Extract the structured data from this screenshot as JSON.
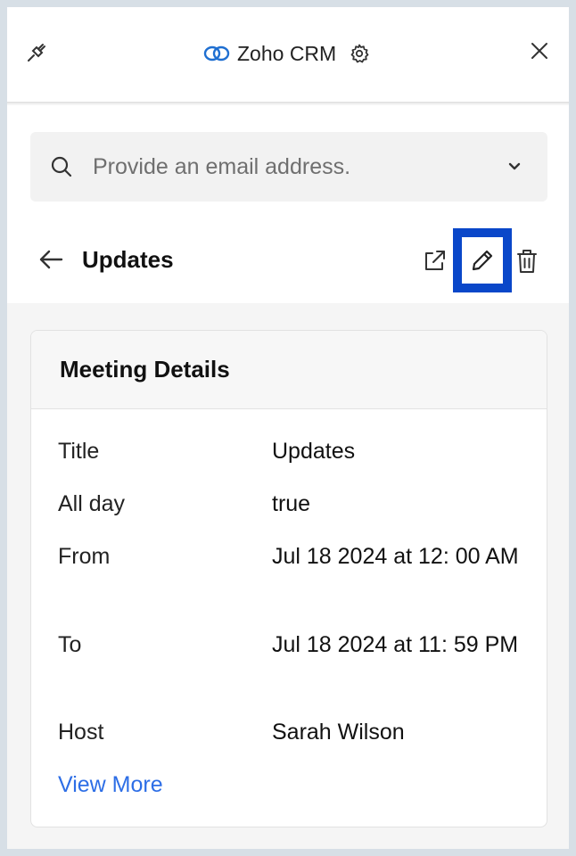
{
  "header": {
    "app_name": "Zoho CRM",
    "icons": [
      "plug-icon",
      "zoho-crm-logo",
      "gear-icon",
      "close-icon"
    ]
  },
  "search": {
    "placeholder": "Provide an email address.",
    "icons": [
      "search-icon",
      "chevron-down-icon"
    ]
  },
  "record": {
    "title": "Updates",
    "actions": [
      "back-arrow-icon",
      "open-external-icon",
      "edit-pencil-icon",
      "trash-icon"
    ]
  },
  "card": {
    "title": "Meeting Details",
    "fields": [
      {
        "label": "Title",
        "value": "Updates"
      },
      {
        "label": "All day",
        "value": "true"
      },
      {
        "label": "From",
        "value": "Jul 18 2024 at 12: 00 AM"
      },
      {
        "label": "To",
        "value": "Jul 18 2024 at 11: 59 PM"
      },
      {
        "label": "Host",
        "value": "Sarah Wilson"
      }
    ],
    "view_more": "View More"
  },
  "colors": {
    "accent": "#0a47c9",
    "link": "#2d6ee6",
    "frame": "#d7dfe6"
  }
}
